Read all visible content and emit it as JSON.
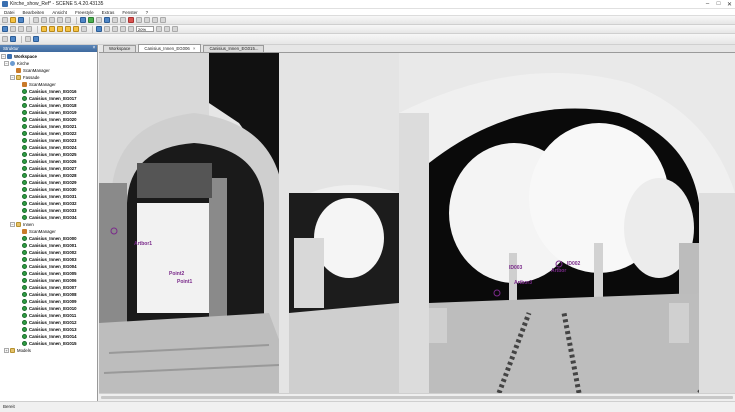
{
  "window": {
    "title": "Kirche_show_Ref* - SCENE 5.4.20.43135",
    "minimize": "–",
    "maximize": "□",
    "close": "✕"
  },
  "menu": {
    "items": [
      "Datei",
      "Bearbeiten",
      "Ansicht",
      "Freestyle",
      "Extras",
      "Fenster",
      "?"
    ]
  },
  "toolbar": {
    "zoom_value": "20%"
  },
  "structure_panel": {
    "title": "Struktur",
    "close": "×"
  },
  "tree": {
    "workspace": "Workspace",
    "project": "Kirche",
    "root_scanmanager": "ScanManager",
    "group_fassade": "Fassade",
    "fassade_scanmanager": "ScanManager",
    "fassade_scans": [
      "Canisius_Innen_EG016",
      "Canisius_Innen_EG017",
      "Canisius_Innen_EG018",
      "Canisius_Innen_EG019",
      "Canisius_Innen_EG020",
      "Canisius_Innen_EG021",
      "Canisius_Innen_EG022",
      "Canisius_Innen_EG023",
      "Canisius_Innen_EG024",
      "Canisius_Innen_EG025",
      "Canisius_Innen_EG026",
      "Canisius_Innen_EG027",
      "Canisius_Innen_EG028",
      "Canisius_Innen_EG029",
      "Canisius_Innen_EG030",
      "Canisius_Innen_EG031",
      "Canisius_Innen_EG032",
      "Canisius_Innen_EG033",
      "Canisius_Innen_EG034"
    ],
    "group_innen": "Innen",
    "innen_scanmanager": "ScanManager",
    "innen_scans": [
      "Canisius_Innen_EG000",
      "Canisius_Innen_EG001",
      "Canisius_Innen_EG002",
      "Canisius_Innen_EG003",
      "Canisius_Innen_EG004",
      "Canisius_Innen_EG005",
      "Canisius_Innen_EG006",
      "Canisius_Innen_EG007",
      "Canisius_Innen_EG008",
      "Canisius_Innen_EG009",
      "Canisius_Innen_EG010",
      "Canisius_Innen_EG011",
      "Canisius_Innen_EG012",
      "Canisius_Innen_EG013",
      "Canisius_Innen_EG014",
      "Canisius_Innen_EG015"
    ],
    "models": "Models"
  },
  "tabs": [
    {
      "label": "Workspace"
    },
    {
      "label": "Canisius_Innen_EG006"
    },
    {
      "label": "Canisius_Innen_EG015..."
    }
  ],
  "view_labels": {
    "artbor1": "Artbor1",
    "point2": "Point2",
    "point1": "Point1",
    "id003": "ID003",
    "id002": "ID002",
    "artbor": "Artbor",
    "artbor3": "Artbor3"
  },
  "status": {
    "text": "Bereit"
  },
  "colors": {
    "accent": "#3f6a9e",
    "label": "#7a2a8a",
    "scan_icon": "#2f9e44"
  }
}
